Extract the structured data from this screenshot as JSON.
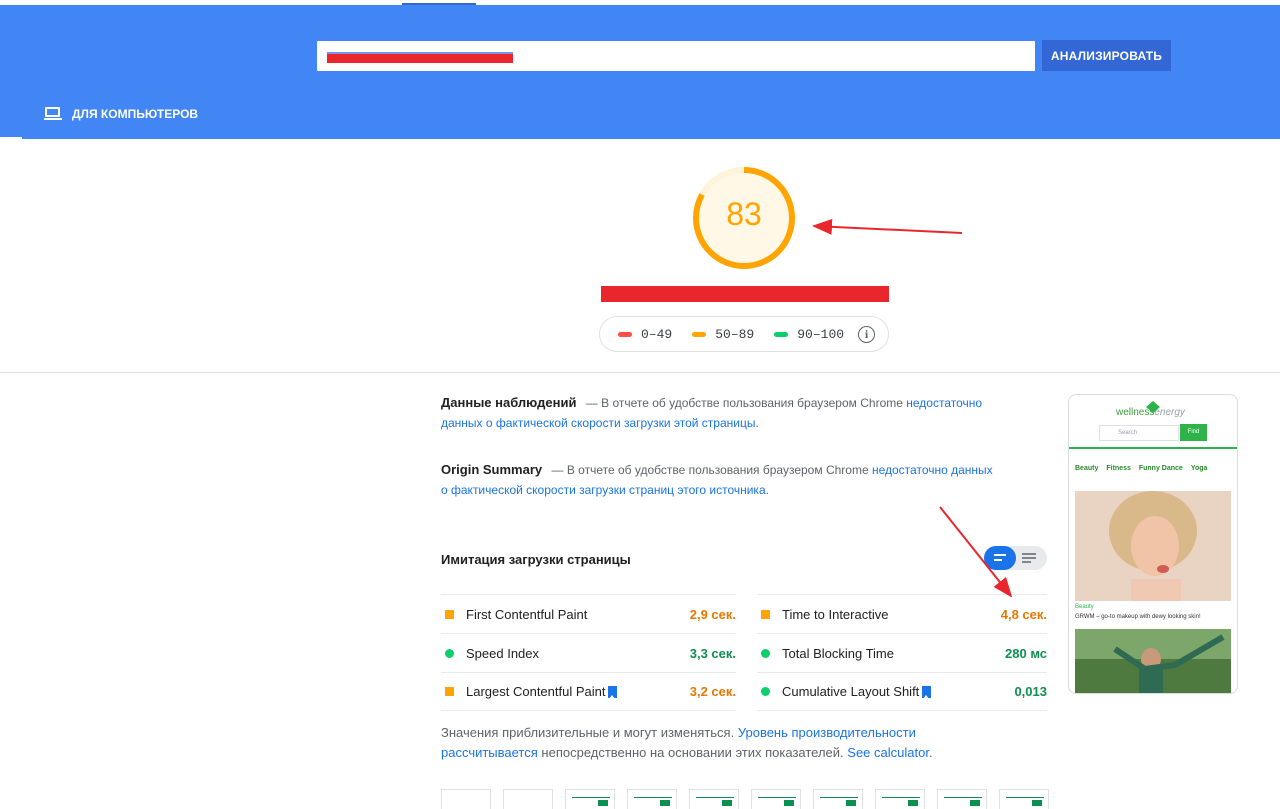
{
  "header": {
    "url_value": "",
    "analyze_label": "АНАЛИЗИРОВАТЬ",
    "device_tab_label": "ДЛЯ КОМПЬЮТЕРОВ",
    "device_icon": "laptop-icon",
    "background_color": "#4285f4"
  },
  "score": {
    "value": "83",
    "fraction": 0.83,
    "color": "#ffa400"
  },
  "legend": {
    "ranges": [
      {
        "label": "0–49",
        "color": "#ff4e42"
      },
      {
        "label": "50–89",
        "color": "#ffa400"
      },
      {
        "label": "90–100",
        "color": "#0cce6b"
      }
    ],
    "info_icon": "info-icon",
    "info_glyph": "i"
  },
  "field_data": {
    "label": "Данные наблюдений",
    "text": "— В отчете об удобстве пользования браузером Chrome",
    "link": "недостаточно данных о фактической скорости загрузки этой страницы",
    "after": "."
  },
  "origin_summary": {
    "label": "Origin Summary",
    "text": "— В отчете об удобстве пользования браузером Chrome",
    "link": "недостаточно данных о фактической скорости загрузки страниц этого источника",
    "after": "."
  },
  "lab": {
    "title": "Имитация загрузки страницы",
    "metrics_left": [
      {
        "name": "First Contentful Paint",
        "value": "2,9 сек.",
        "status": "average",
        "bookmark": false
      },
      {
        "name": "Speed Index",
        "value": "3,3 сек.",
        "status": "pass",
        "bookmark": false
      },
      {
        "name": "Largest Contentful Paint",
        "value": "3,2 сек.",
        "status": "average",
        "bookmark": true
      }
    ],
    "metrics_right": [
      {
        "name": "Time to Interactive",
        "value": "4,8 сек.",
        "status": "average",
        "bookmark": false
      },
      {
        "name": "Total Blocking Time",
        "value": "280 мс",
        "status": "pass",
        "bookmark": false
      },
      {
        "name": "Cumulative Layout Shift",
        "value": "0,013",
        "status": "pass",
        "bookmark": true
      }
    ]
  },
  "note": {
    "text1": "Значения приблизительные и могут изменяться. ",
    "link1": "Уровень производительности рассчитывается",
    "text2": " непосредственно на основании этих показателей. ",
    "link2": "See calculator",
    "text3": "."
  },
  "preview": {
    "logo_word1": "wellness",
    "logo_word2": "energy",
    "search_placeholder": "Search",
    "find_label": "Find",
    "nav": [
      "Beauty",
      "Fitness",
      "Funny Dance",
      "Yoga"
    ],
    "category": "Beauty",
    "headline": "GRWM – go-to makeup with dewy looking skin!"
  }
}
